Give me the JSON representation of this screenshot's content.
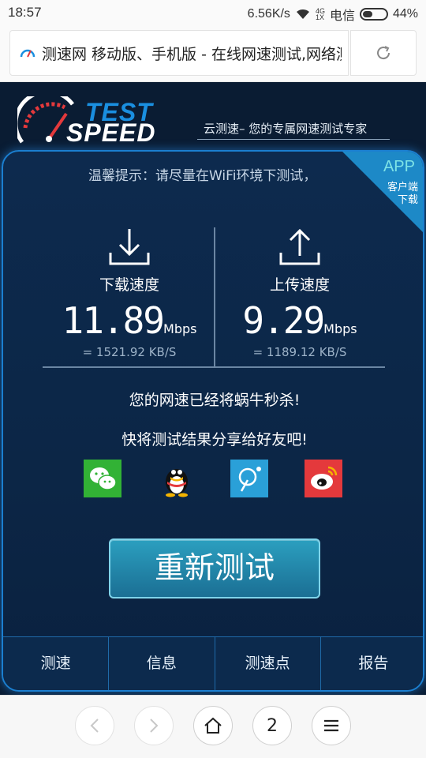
{
  "status": {
    "time": "18:57",
    "speed": "6.56K/s",
    "signal_top": "4G",
    "signal_bottom": "1X",
    "carrier": "电信",
    "battery": "44%"
  },
  "browser": {
    "url_title": "测速网 移动版、手机版 - 在线网速测试,网络测速"
  },
  "header": {
    "logo_test": "TEST",
    "logo_speed": "SPEED",
    "slogan": "云测速– 您的专属网速测试专家"
  },
  "tip": "温馨提示：请尽量在WiFi环境下测试，",
  "app_corner": {
    "app": "APP",
    "line1": "客户端",
    "line2": "下载"
  },
  "download": {
    "label": "下载速度",
    "value": "11.89",
    "unit": "Mbps",
    "kb": "= 1521.92 KB/S"
  },
  "upload": {
    "label": "上传速度",
    "value": "9.29",
    "unit": "Mbps",
    "kb": "= 1189.12 KB/S"
  },
  "messages": {
    "line1": "您的网速已经将蜗牛秒杀!",
    "line2": "快将测试结果分享给好友吧!"
  },
  "share": [
    "wechat-icon",
    "qq-icon",
    "qzone-icon",
    "weibo-icon"
  ],
  "retest_label": "重新测试",
  "tabs": [
    "测速",
    "信息",
    "测速点",
    "报告"
  ],
  "bottom_nav": {
    "tab_count": "2"
  },
  "colors": {
    "accent": "#1b7fd0",
    "page_bg": "#0a1c33",
    "button": "#2b9fbf"
  }
}
